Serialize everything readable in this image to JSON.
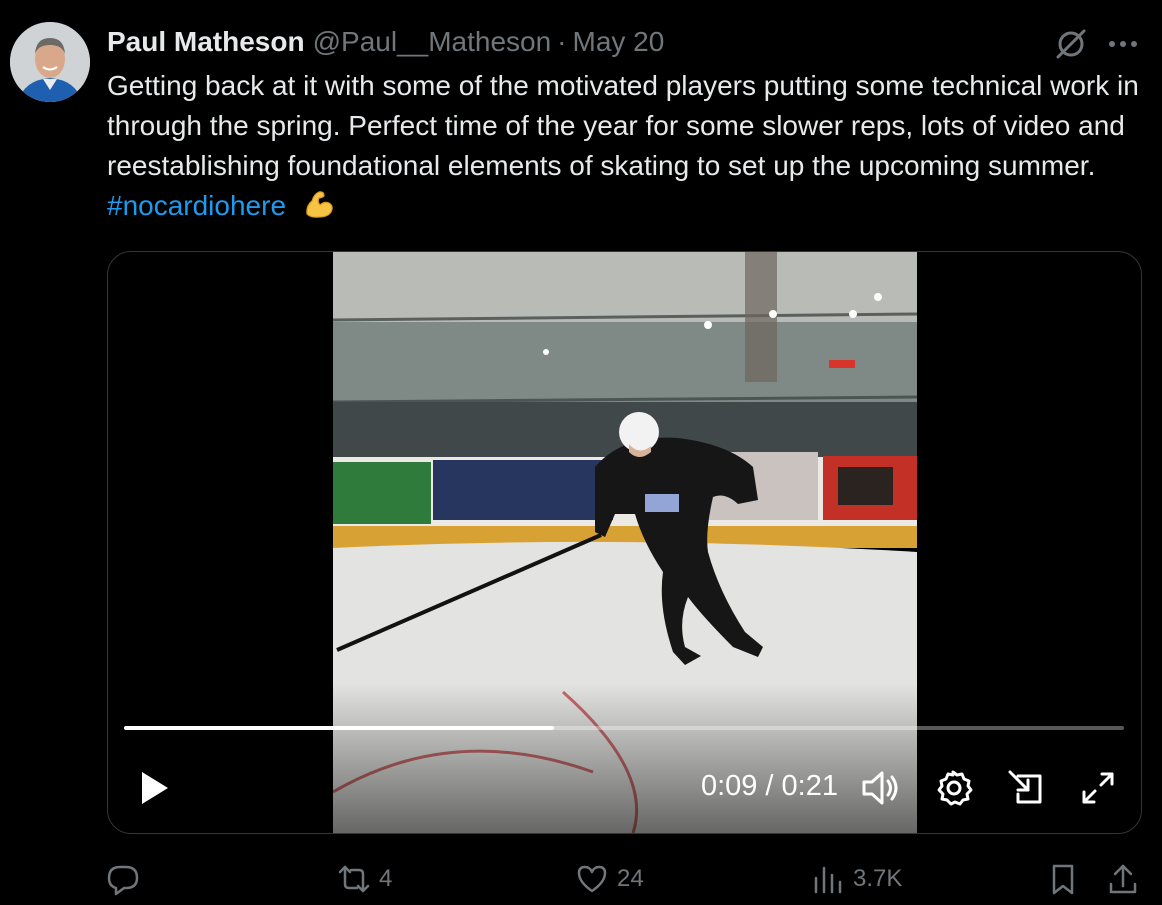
{
  "user": {
    "name": "Paul Matheson",
    "handle": "@Paul__Matheson",
    "separator": "·",
    "date": "May 20"
  },
  "tweet": {
    "text": "Getting back at it with some of the motivated players putting some technical work in through the spring. Perfect time of the year for some slower reps, lots of video and reestablishing foundational elements of skating to set up the upcoming summer.",
    "hashtag": "#nocardiohere",
    "emoji": "flexed-biceps"
  },
  "video": {
    "current_time": "0:09",
    "duration": "0:21",
    "time_display": "0:09 / 0:21",
    "progress_fraction": 0.43,
    "controls": [
      "play-icon",
      "volume-icon",
      "settings-icon",
      "dock-icon",
      "fullscreen-icon"
    ]
  },
  "actions": {
    "replies": "",
    "reposts": "4",
    "likes": "24",
    "views": "3.7K"
  },
  "colors": {
    "background": "#000000",
    "text": "#e7e9ea",
    "secondary": "#71767b",
    "link": "#1d9bf0"
  }
}
